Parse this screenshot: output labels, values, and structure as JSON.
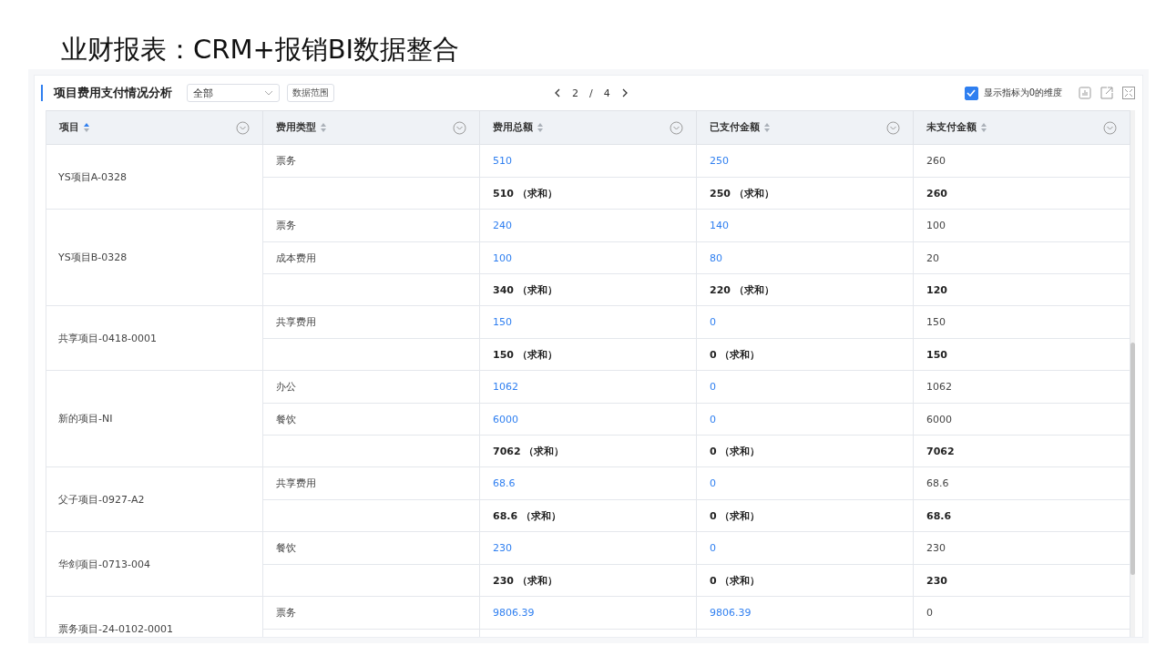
{
  "page_title": "业财报表：CRM+报销BI数据整合",
  "panel": {
    "title": "项目费用支付情况分析",
    "filter": {
      "value": "全部"
    },
    "range_button": "数据范围",
    "pager": {
      "current": "2",
      "separator": "/",
      "total": "4"
    },
    "zero_toggle": {
      "label": "显示指标为0的维度",
      "checked": true
    }
  },
  "table": {
    "columns": [
      {
        "label": "项目",
        "sorted": true
      },
      {
        "label": "费用类型",
        "sorted": false
      },
      {
        "label": "费用总额",
        "sorted": false
      },
      {
        "label": "已支付金额",
        "sorted": false
      },
      {
        "label": "未支付金额",
        "sorted": false
      }
    ],
    "groups": [
      {
        "project": "YS项目A-0328",
        "clipped": false,
        "rows": [
          {
            "kind": "detail",
            "type": "票务",
            "total": "510",
            "paid": "250",
            "unpaid": "260"
          },
          {
            "kind": "sum",
            "total": "510 （求和）",
            "paid": "250 （求和）",
            "unpaid": "260"
          }
        ]
      },
      {
        "project": "YS项目B-0328",
        "clipped": false,
        "rows": [
          {
            "kind": "detail",
            "type": "票务",
            "total": "240",
            "paid": "140",
            "unpaid": "100"
          },
          {
            "kind": "detail",
            "type": "成本费用",
            "total": "100",
            "paid": "80",
            "unpaid": "20"
          },
          {
            "kind": "sum",
            "total": "340 （求和）",
            "paid": "220 （求和）",
            "unpaid": "120"
          }
        ]
      },
      {
        "project": "共享项目-0418-0001",
        "clipped": false,
        "rows": [
          {
            "kind": "detail",
            "type": "共享费用",
            "total": "150",
            "paid": "0",
            "unpaid": "150"
          },
          {
            "kind": "sum",
            "total": "150 （求和）",
            "paid": "0 （求和）",
            "unpaid": "150"
          }
        ]
      },
      {
        "project": "新的项目-NI",
        "clipped": false,
        "rows": [
          {
            "kind": "detail",
            "type": "办公",
            "total": "1062",
            "paid": "0",
            "unpaid": "1062"
          },
          {
            "kind": "detail",
            "type": "餐饮",
            "total": "6000",
            "paid": "0",
            "unpaid": "6000"
          },
          {
            "kind": "sum",
            "total": "7062 （求和）",
            "paid": "0 （求和）",
            "unpaid": "7062"
          }
        ]
      },
      {
        "project": "父子项目-0927-A2",
        "clipped": false,
        "rows": [
          {
            "kind": "detail",
            "type": "共享费用",
            "total": "68.6",
            "paid": "0",
            "unpaid": "68.6"
          },
          {
            "kind": "sum",
            "total": "68.6 （求和）",
            "paid": "0 （求和）",
            "unpaid": "68.6"
          }
        ]
      },
      {
        "project": "华剑项目-0713-004",
        "clipped": false,
        "rows": [
          {
            "kind": "detail",
            "type": "餐饮",
            "total": "230",
            "paid": "0",
            "unpaid": "230"
          },
          {
            "kind": "sum",
            "total": "230 （求和）",
            "paid": "0 （求和）",
            "unpaid": "230"
          }
        ]
      },
      {
        "project": "票务项目-24-0102-0001",
        "clipped": true,
        "rows": [
          {
            "kind": "detail",
            "type": "票务",
            "total": "9806.39",
            "paid": "9806.39",
            "unpaid": "0"
          }
        ]
      }
    ]
  }
}
